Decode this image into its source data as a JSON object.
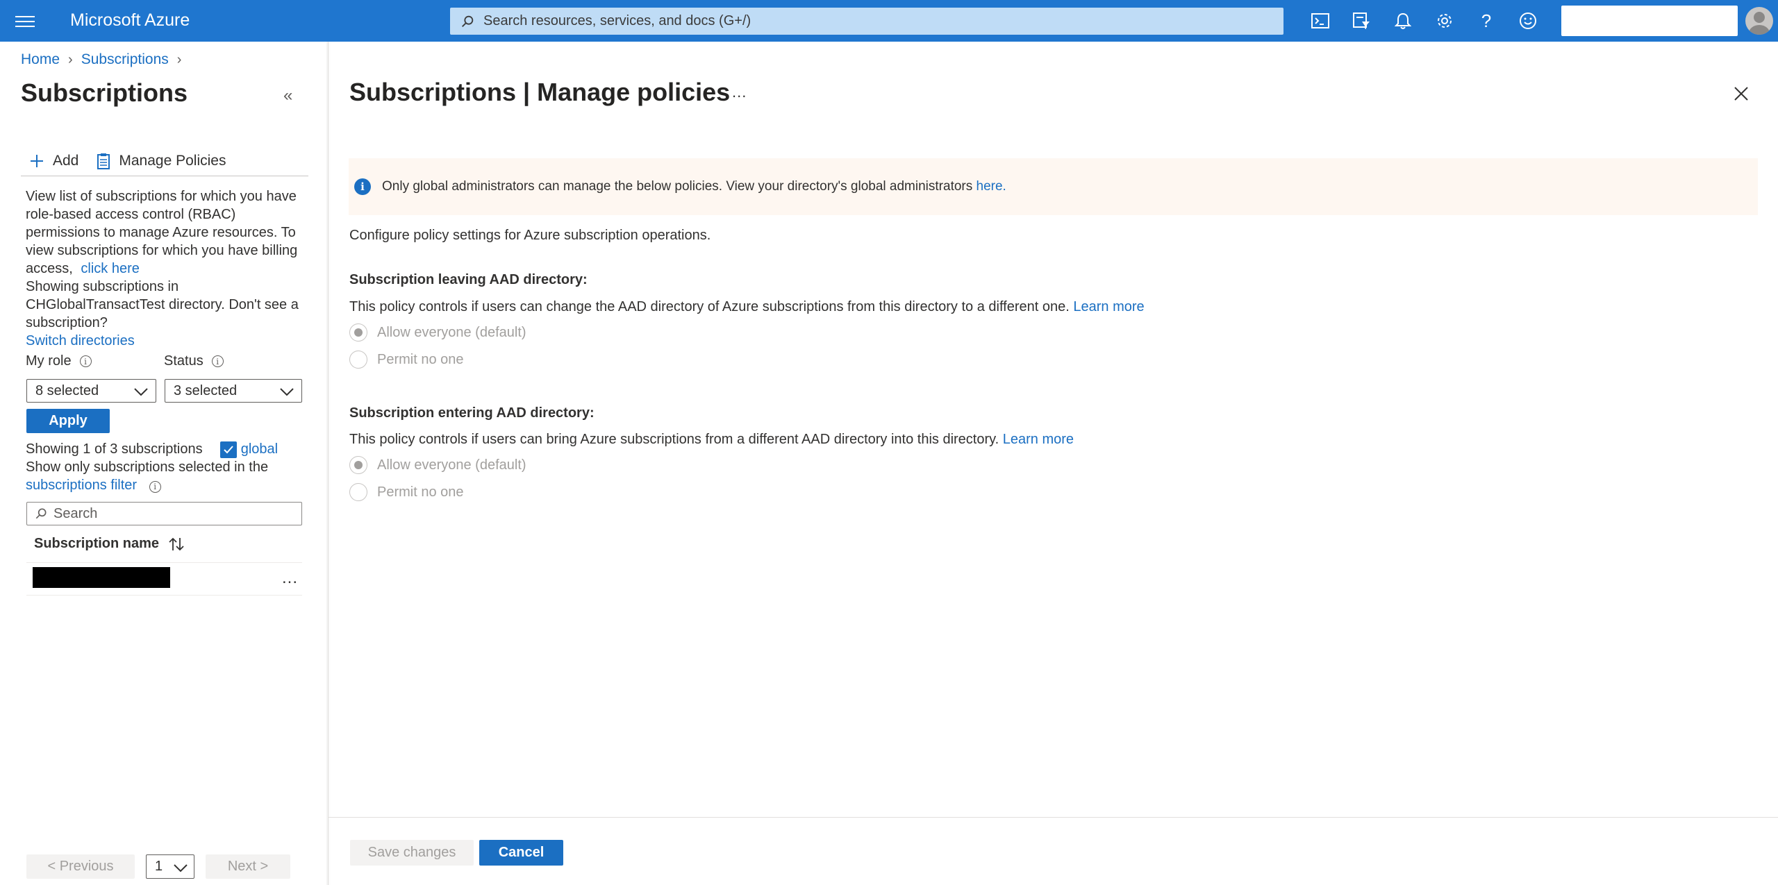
{
  "topbar": {
    "brand": "Microsoft Azure",
    "search_placeholder": "Search resources, services, and docs (G+/)",
    "icons": [
      "cloud-shell-icon",
      "directory-filter-icon",
      "notifications-icon",
      "settings-icon",
      "help-icon",
      "feedback-icon"
    ]
  },
  "breadcrumb": {
    "items": [
      "Home",
      "Subscriptions"
    ]
  },
  "left": {
    "title": "Subscriptions",
    "toolbar": {
      "add_label": "Add",
      "manage_label": "Manage Policies"
    },
    "description": {
      "text1": "View list of subscriptions for which you have role-based access control (RBAC) permissions to manage Azure resources. To view subscriptions for which you have billing access,",
      "click_here": "click here",
      "text2": "Showing subscriptions in CHGlobalTransactTest directory. Don't see a subscription?",
      "switch_dirs": "Switch directories"
    },
    "filters": {
      "role_label": "My role",
      "role_value": "8 selected",
      "status_label": "Status",
      "status_value": "3 selected",
      "apply_label": "Apply"
    },
    "showing": {
      "count_text": "Showing 1 of 3 subscriptions",
      "global_label": "global",
      "only_text": "Show only subscriptions selected in the",
      "filter_link": "subscriptions filter"
    },
    "search_placeholder": "Search",
    "table": {
      "column": "Subscription name",
      "rows": [
        {
          "name": "",
          "more": "..."
        }
      ]
    },
    "pager": {
      "prev": "< Previous",
      "page": "1",
      "next": "Next >"
    }
  },
  "blade": {
    "title": "Subscriptions | Manage policies",
    "more": "...",
    "banner": {
      "text": "Only global administrators can manage the below policies. View your directory's global administrators",
      "link": "here."
    },
    "configure": "Configure policy settings for Azure subscription operations.",
    "section1": {
      "title": "Subscription leaving AAD directory:",
      "desc": "This policy controls if users can change the AAD directory of Azure subscriptions from this directory to a different one.",
      "learn": "Learn more",
      "opt1": "Allow everyone (default)",
      "opt2": "Permit no one"
    },
    "section2": {
      "title": "Subscription entering AAD directory:",
      "desc": "This policy controls if users can bring Azure subscriptions from a different AAD directory into this directory.",
      "learn": "Learn more",
      "opt1": "Allow everyone (default)",
      "opt2": "Permit no one"
    },
    "footer": {
      "save": "Save changes",
      "cancel": "Cancel"
    }
  },
  "colors": {
    "topbar": "#1f76cf",
    "accent": "#1b6fc2",
    "banner_bg": "#fef7f1"
  }
}
